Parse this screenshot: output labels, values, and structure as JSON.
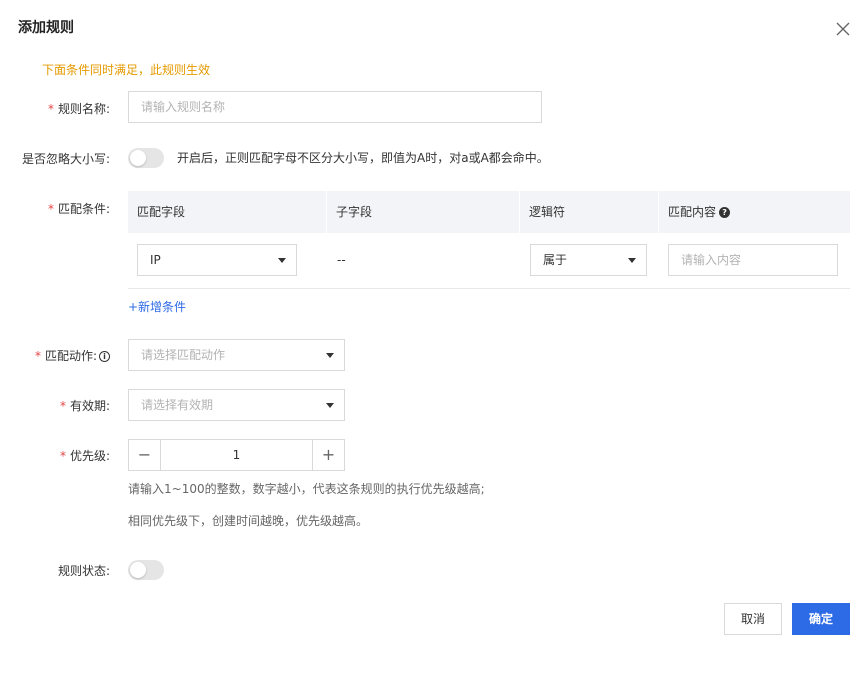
{
  "dialog": {
    "title": "添加规则",
    "notice": "下面条件同时满足，此规则生效"
  },
  "rule_name": {
    "label": "规则名称:",
    "placeholder": "请输入规则名称"
  },
  "ignore_case": {
    "label": "是否忽略大小写:",
    "description": "开启后，正则匹配字母不区分大小写，即值为A时，对a或A都会命中。",
    "enabled": false
  },
  "match_conditions": {
    "label": "匹配条件:",
    "columns": [
      "匹配字段",
      "子字段",
      "逻辑符",
      "匹配内容"
    ],
    "row": {
      "field": "IP",
      "subfield": "--",
      "operator": "属于",
      "content_placeholder": "请输入内容"
    },
    "add_label": "+新增条件"
  },
  "match_action": {
    "label": "匹配动作:",
    "placeholder": "请选择匹配动作"
  },
  "validity": {
    "label": "有效期:",
    "placeholder": "请选择有效期"
  },
  "priority": {
    "label": "优先级:",
    "value": "1",
    "minus": "−",
    "plus": "+",
    "hint1": "请输入1~100的整数，数字越小，代表这条规则的执行优先级越高;",
    "hint2": "相同优先级下，创建时间越晚，优先级越高。"
  },
  "rule_status": {
    "label": "规则状态:",
    "enabled": false
  },
  "footer": {
    "cancel": "取消",
    "confirm": "确定"
  },
  "colors": {
    "primary": "#2d6ae6",
    "notice": "#e59a00",
    "required": "#e54545"
  }
}
